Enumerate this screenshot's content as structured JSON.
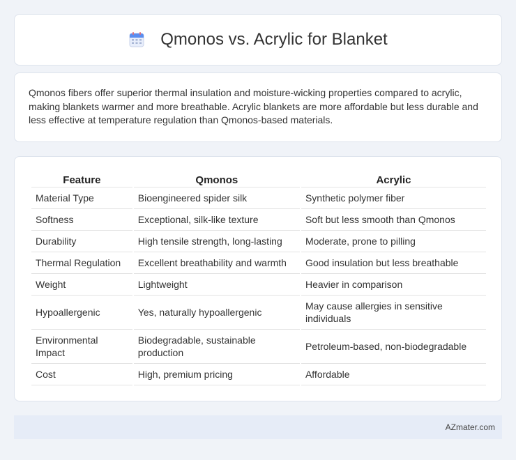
{
  "header": {
    "title": "Qmonos vs. Acrylic for Blanket",
    "icon": "calendar-icon"
  },
  "summary": "Qmonos fibers offer superior thermal insulation and moisture-wicking properties compared to acrylic, making blankets warmer and more breathable. Acrylic blankets are more affordable but less durable and less effective at temperature regulation than Qmonos-based materials.",
  "table": {
    "headers": [
      "Feature",
      "Qmonos",
      "Acrylic"
    ],
    "rows": [
      [
        "Material Type",
        "Bioengineered spider silk",
        "Synthetic polymer fiber"
      ],
      [
        "Softness",
        "Exceptional, silk-like texture",
        "Soft but less smooth than Qmonos"
      ],
      [
        "Durability",
        "High tensile strength, long-lasting",
        "Moderate, prone to pilling"
      ],
      [
        "Thermal Regulation",
        "Excellent breathability and warmth",
        "Good insulation but less breathable"
      ],
      [
        "Weight",
        "Lightweight",
        "Heavier in comparison"
      ],
      [
        "Hypoallergenic",
        "Yes, naturally hypoallergenic",
        "May cause allergies in sensitive individuals"
      ],
      [
        "Environmental Impact",
        "Biodegradable, sustainable production",
        "Petroleum-based, non-biodegradable"
      ],
      [
        "Cost",
        "High, premium pricing",
        "Affordable"
      ]
    ]
  },
  "footer": {
    "brand": "AZmater.com"
  }
}
